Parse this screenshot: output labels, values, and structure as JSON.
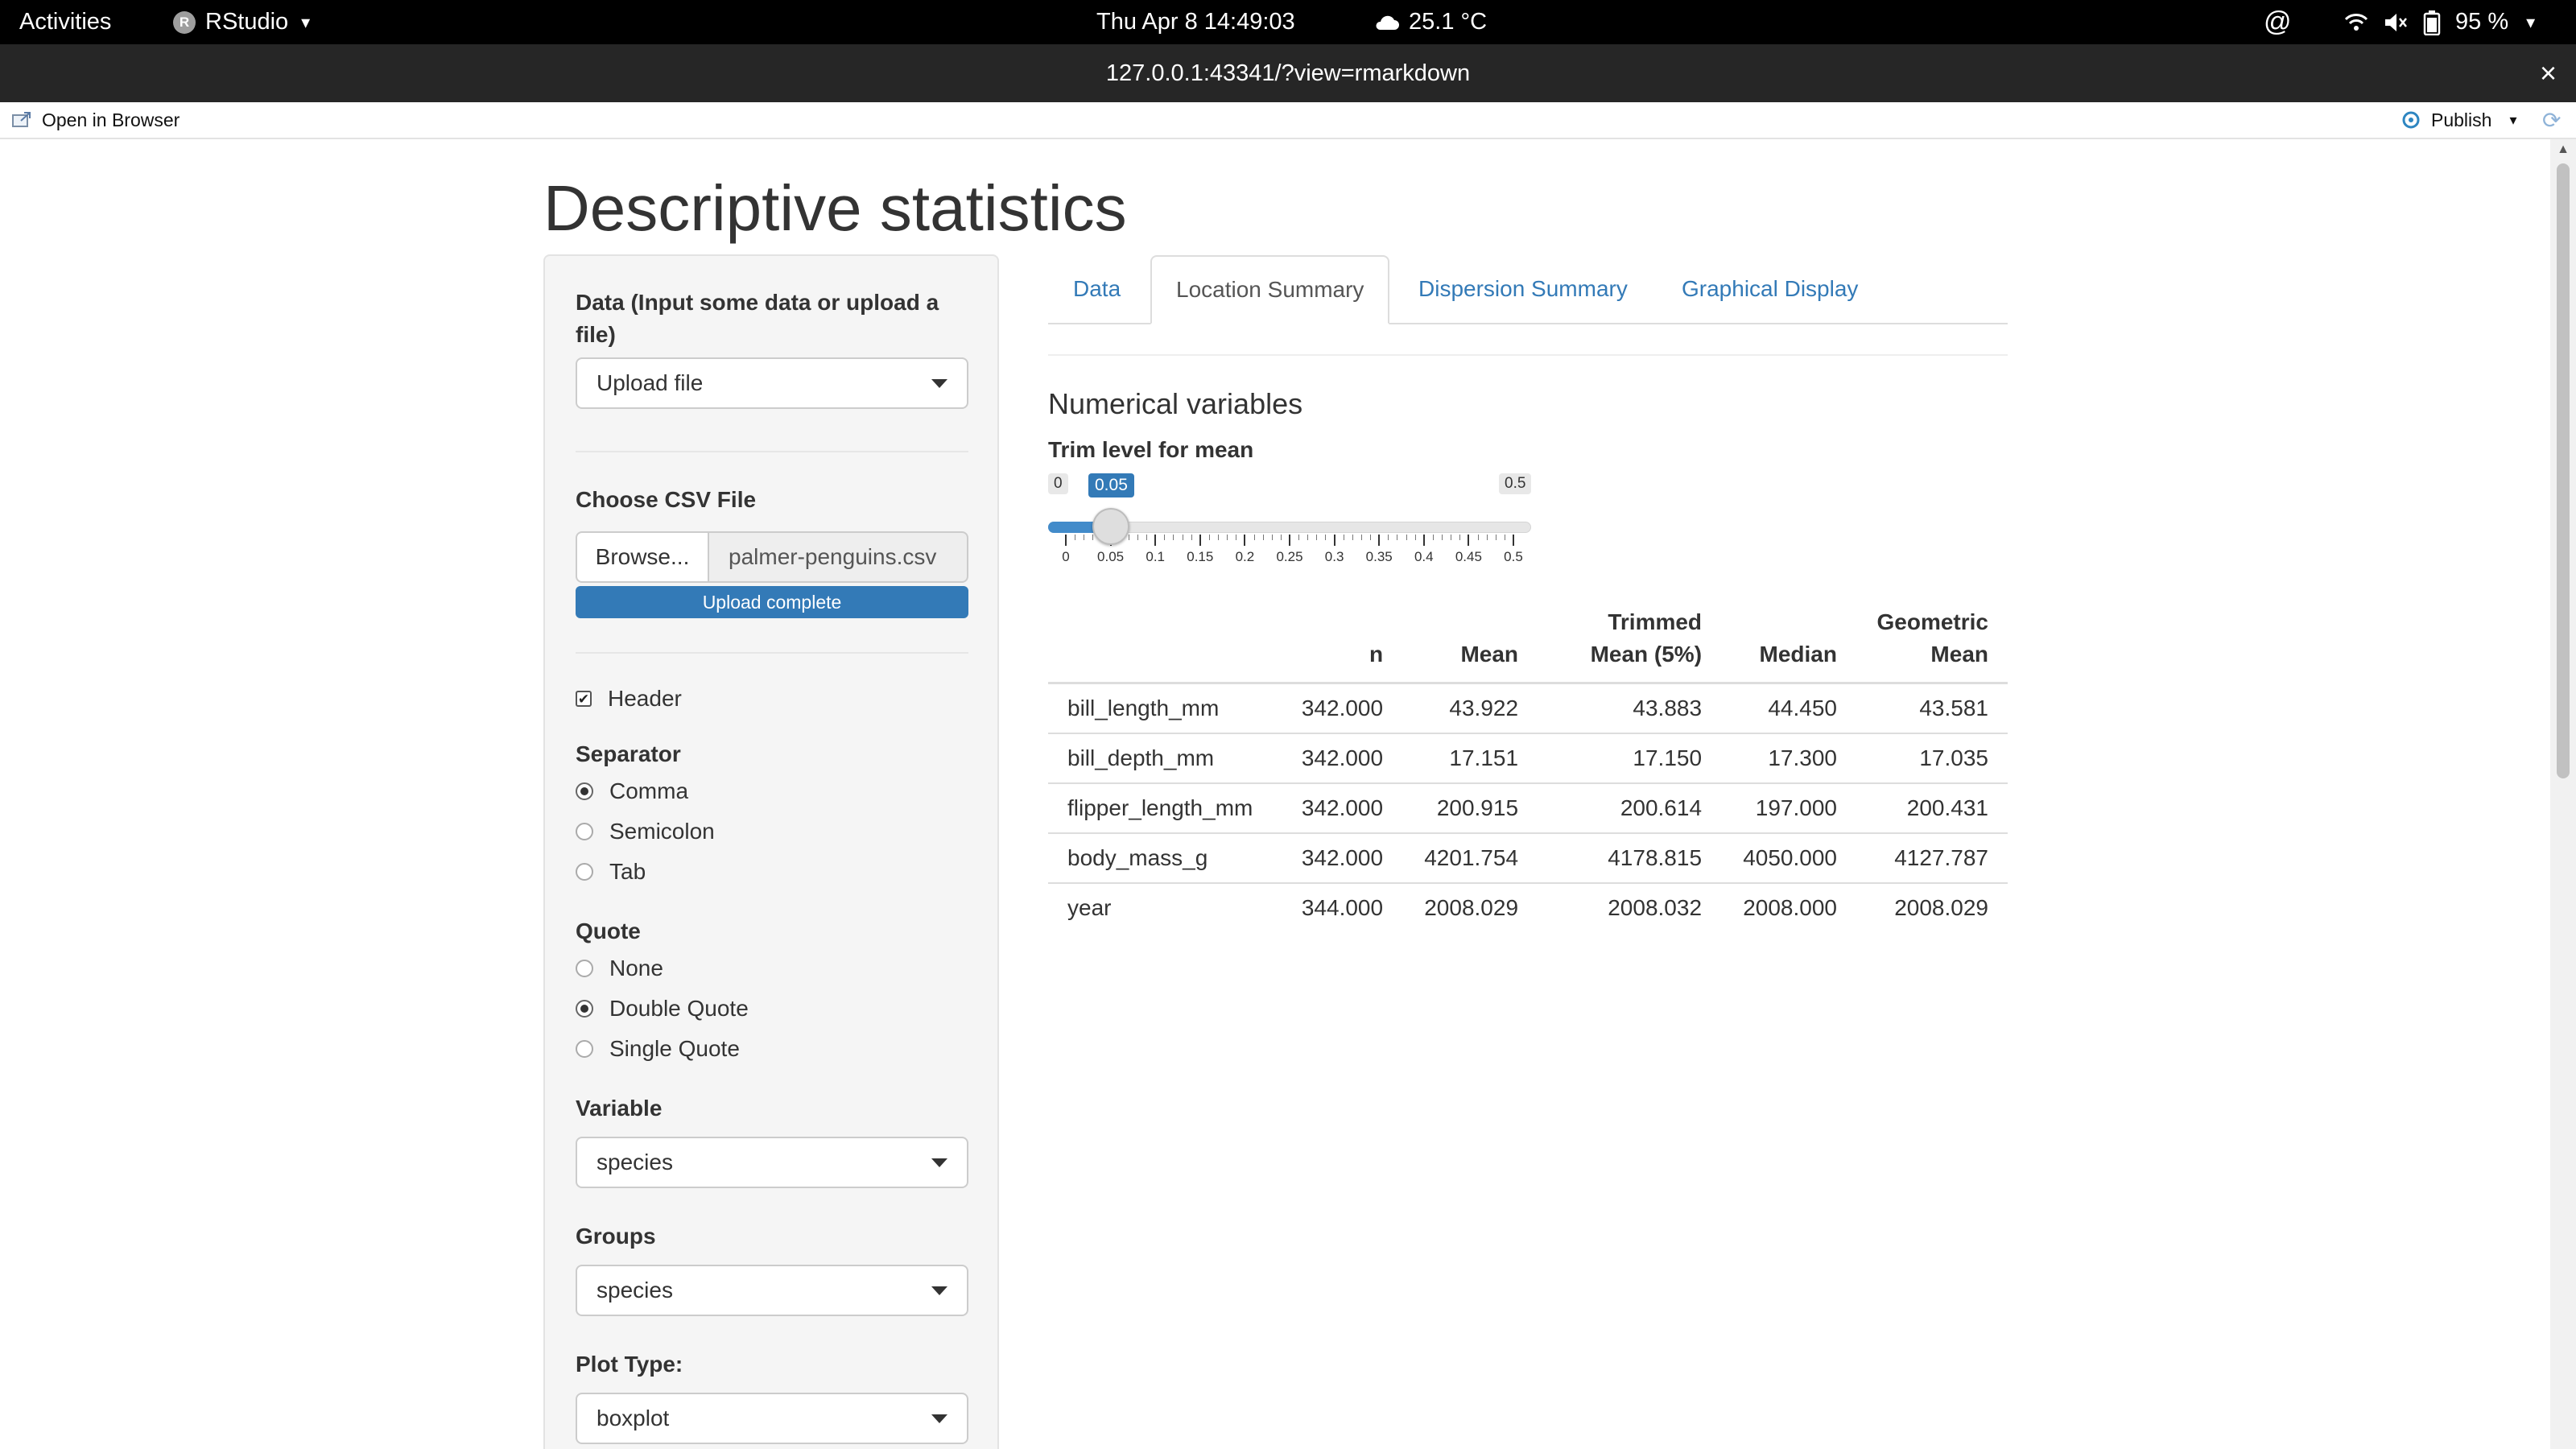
{
  "system_bar": {
    "activities": "Activities",
    "app_name": "RStudio",
    "app_icon_letter": "R",
    "datetime": "Thu Apr 8  14:49:03",
    "weather": "25.1 °C",
    "battery": "95 %"
  },
  "window": {
    "url": "127.0.0.1:43341/?view=rmarkdown",
    "close_symbol": "×"
  },
  "viewer_toolbar": {
    "open_in_browser": "Open in Browser",
    "publish": "Publish"
  },
  "page": {
    "title": "Descriptive statistics"
  },
  "sidebar": {
    "data_label": "Data (Input some data or upload a file)",
    "data_select": "Upload file",
    "csv_label": "Choose CSV File",
    "browse": "Browse...",
    "file_name": "palmer-penguins.csv",
    "upload_status": "Upload complete",
    "upload_progress": 1.0,
    "header_label": "Header",
    "header_checked": true,
    "separator_label": "Separator",
    "separator_options": [
      "Comma",
      "Semicolon",
      "Tab"
    ],
    "separator_selected": "Comma",
    "quote_label": "Quote",
    "quote_options": [
      "None",
      "Double Quote",
      "Single Quote"
    ],
    "quote_selected": "Double Quote",
    "variable_label": "Variable",
    "variable_select": "species",
    "groups_label": "Groups",
    "groups_select": "species",
    "plot_type_label": "Plot Type:",
    "plot_type_select": "boxplot"
  },
  "tabs": [
    "Data",
    "Location Summary",
    "Dispersion Summary",
    "Graphical Display"
  ],
  "active_tab": "Location Summary",
  "main": {
    "section_title": "Numerical variables",
    "trim_label": "Trim level for mean",
    "slider": {
      "min_label": "0",
      "max_label": "0.5",
      "value_label": "0.05",
      "min": 0,
      "max": 0.5,
      "value": 0.05,
      "ticks": [
        "0",
        "0.05",
        "0.1",
        "0.15",
        "0.2",
        "0.25",
        "0.3",
        "0.35",
        "0.4",
        "0.45",
        "0.5"
      ]
    },
    "table": {
      "headers": [
        "",
        "n",
        "Mean",
        "Trimmed Mean (5%)",
        "Median",
        "Geometric Mean"
      ],
      "rows": [
        [
          "bill_length_mm",
          "342.000",
          "43.922",
          "43.883",
          "44.450",
          "43.581"
        ],
        [
          "bill_depth_mm",
          "342.000",
          "17.151",
          "17.150",
          "17.300",
          "17.035"
        ],
        [
          "flipper_length_mm",
          "342.000",
          "200.915",
          "200.614",
          "197.000",
          "200.431"
        ],
        [
          "body_mass_g",
          "342.000",
          "4201.754",
          "4178.815",
          "4050.000",
          "4127.787"
        ],
        [
          "year",
          "344.000",
          "2008.029",
          "2008.032",
          "2008.000",
          "2008.029"
        ]
      ]
    }
  }
}
